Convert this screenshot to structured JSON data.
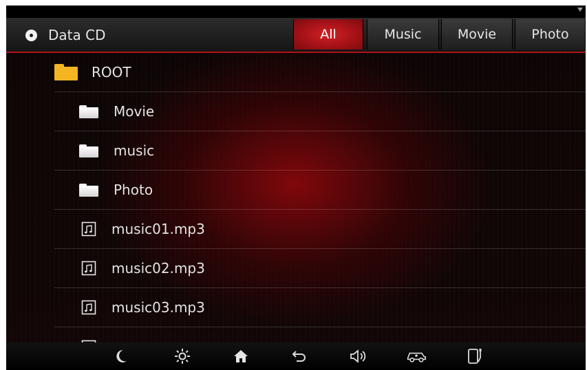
{
  "header": {
    "source_icon": "disc-icon",
    "source_label": "Data CD",
    "tabs": [
      {
        "label": "All",
        "active": true
      },
      {
        "label": "Music",
        "active": false
      },
      {
        "label": "Movie",
        "active": false
      },
      {
        "label": "Photo",
        "active": false
      }
    ],
    "accent_color": "#b11216"
  },
  "list": {
    "root": {
      "label": "ROOT",
      "icon": "folder-icon",
      "color": "#f5b522"
    },
    "items": [
      {
        "label": "Movie",
        "type": "folder",
        "icon": "folder-icon"
      },
      {
        "label": "music",
        "type": "folder",
        "icon": "folder-icon"
      },
      {
        "label": "Photo",
        "type": "folder",
        "icon": "folder-icon"
      },
      {
        "label": "music01.mp3",
        "type": "file",
        "icon": "music-file-icon"
      },
      {
        "label": "music02.mp3",
        "type": "file",
        "icon": "music-file-icon"
      },
      {
        "label": "music03.mp3",
        "type": "file",
        "icon": "music-file-icon"
      }
    ]
  },
  "footer": {
    "buttons": [
      {
        "icon": "moon-icon"
      },
      {
        "icon": "brightness-icon"
      },
      {
        "icon": "home-icon"
      },
      {
        "icon": "back-icon"
      },
      {
        "icon": "volume-icon"
      },
      {
        "icon": "car-icon"
      },
      {
        "icon": "phone-connect-icon"
      }
    ]
  }
}
